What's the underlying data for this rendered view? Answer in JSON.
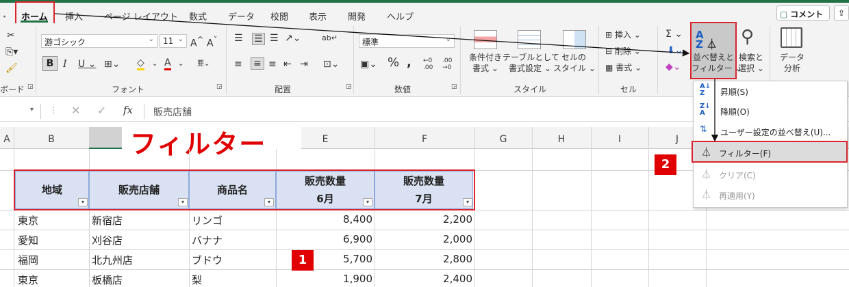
{
  "colors": {
    "accent": "#217346",
    "red": "#d9242c",
    "header_fill": "#d9e1f2"
  },
  "tabs": [
    "ホーム",
    "挿入",
    "ページ レイアウト",
    "数式",
    "データ",
    "校閲",
    "表示",
    "開発",
    "ヘルプ"
  ],
  "comment_button": "コメント",
  "ribbon": {
    "font_name": "游ゴシック",
    "font_size": "11",
    "number_format": "標準",
    "paste_group_label": "ボード",
    "group_labels": [
      "フォント",
      "配置",
      "数値",
      "スタイル",
      "セル"
    ],
    "conditional_format": [
      "条件付き",
      "書式"
    ],
    "format_as_table": [
      "テーブルとして",
      "書式設定"
    ],
    "cell_styles": [
      "セルの",
      "スタイル"
    ],
    "insert": "挿入",
    "delete": "削除",
    "format": "書式",
    "sort_filter": [
      "並べ替えと",
      "フィルター"
    ],
    "find_select": [
      "検索と",
      "選択"
    ],
    "data_analysis": [
      "データ",
      "分析"
    ]
  },
  "formula_bar": {
    "fx": "fx",
    "value": "販売店舗"
  },
  "column_headers": [
    "A",
    "B",
    "C",
    "D",
    "E",
    "F",
    "G",
    "H",
    "I",
    "J"
  ],
  "annotation_title": "フィルター",
  "table": {
    "headers": [
      [
        "地域"
      ],
      [
        "販売店舗"
      ],
      [
        "商品名"
      ],
      [
        "販売数量",
        "6月"
      ],
      [
        "販売数量",
        "7月"
      ]
    ],
    "rows": [
      [
        "東京",
        "新宿店",
        "リンゴ",
        "8,400",
        "2,200"
      ],
      [
        "愛知",
        "刈谷店",
        "バナナ",
        "6,900",
        "2,000"
      ],
      [
        "福岡",
        "北九州店",
        "ブドウ",
        "5,700",
        "2,800"
      ],
      [
        "東京",
        "板橋店",
        "梨",
        "1,900",
        "2,400"
      ]
    ]
  },
  "badges": [
    "1",
    "2"
  ],
  "menu": {
    "items": [
      {
        "label": "昇順(S)",
        "icon": "sort-ascending-icon",
        "enabled": true
      },
      {
        "label": "降順(O)",
        "icon": "sort-descending-icon",
        "enabled": true
      },
      {
        "label": "ユーザー設定の並べ替え(U)...",
        "icon": "custom-sort-icon",
        "enabled": true
      },
      {
        "label": "フィルター(F)",
        "icon": "filter-icon",
        "enabled": true,
        "highlighted": true
      },
      {
        "label": "クリア(C)",
        "icon": "clear-filter-icon",
        "enabled": false
      },
      {
        "label": "再適用(Y)",
        "icon": "reapply-icon",
        "enabled": false
      }
    ]
  }
}
